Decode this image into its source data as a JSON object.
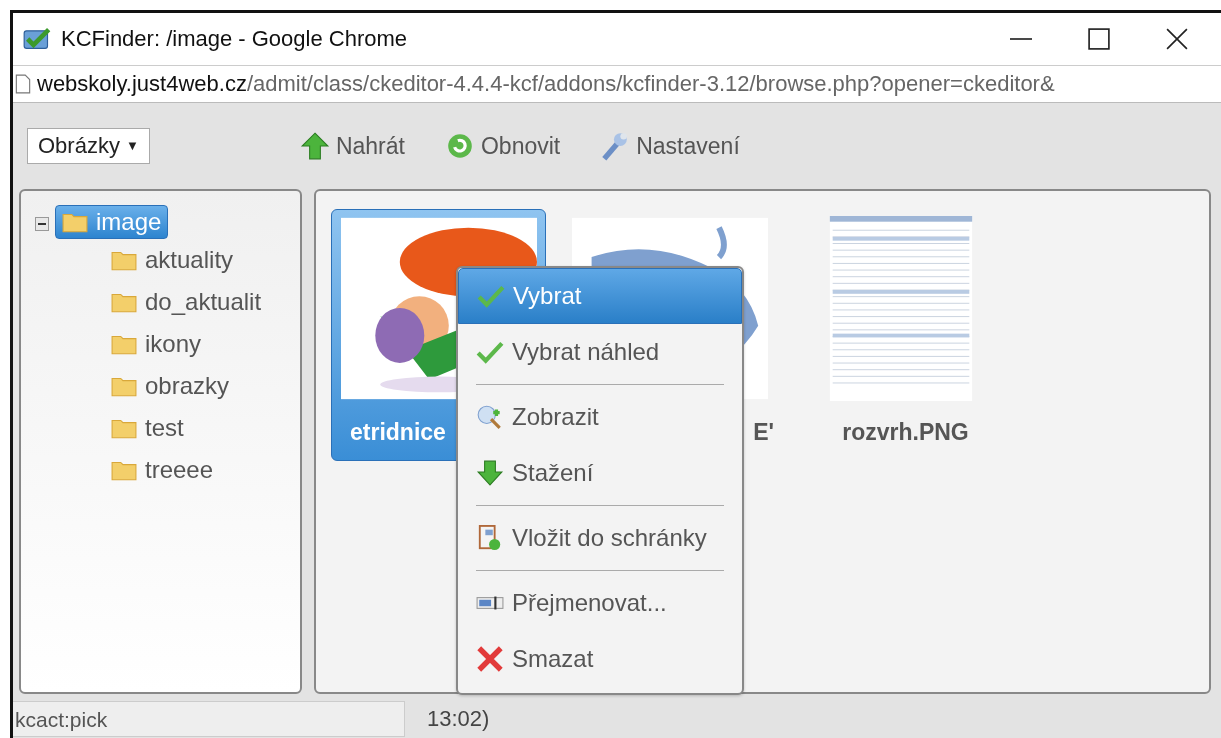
{
  "window": {
    "title": "KCFinder: /image - Google Chrome"
  },
  "address_bar": {
    "host": "webskoly.just4web.cz",
    "path": "/admit/class/ckeditor-4.4.4-kcf/addons/kcfinder-3.12/browse.php?opener=ckeditor&"
  },
  "type_select": {
    "value": "Obrázky",
    "caret": "▼"
  },
  "toolbar": [
    {
      "label": "Nahrát",
      "kind": "upload"
    },
    {
      "label": "Obnovit",
      "kind": "refresh"
    },
    {
      "label": "Nastavení",
      "kind": "settings"
    }
  ],
  "tree": {
    "label": "image",
    "expanded": true,
    "selected": true,
    "children": [
      {
        "label": "aktuality",
        "selected": false
      },
      {
        "label": "do_aktualit",
        "selected": false
      },
      {
        "label": "ikony",
        "selected": false
      },
      {
        "label": "obrazky",
        "selected": false
      },
      {
        "label": "test",
        "selected": false
      },
      {
        "label": "treeee",
        "selected": false
      }
    ]
  },
  "files": [
    {
      "name": "etridnice",
      "selected": true,
      "kind": "cartoon"
    },
    {
      "name": "E'",
      "selected": false,
      "kind": "map"
    },
    {
      "name": "rozvrh.PNG",
      "selected": false,
      "kind": "table"
    }
  ],
  "context_menu": [
    [
      {
        "label": "Vybrat",
        "kind": "check",
        "selected": true
      },
      {
        "label": "Vybrat náhled",
        "kind": "check",
        "selected": false
      }
    ],
    [
      {
        "label": "Zobrazit",
        "kind": "view",
        "selected": false
      },
      {
        "label": "Stažení",
        "kind": "download",
        "selected": false
      }
    ],
    [
      {
        "label": "Vložit do schránky",
        "kind": "clipboard",
        "selected": false
      }
    ],
    [
      {
        "label": "Přejmenovat...",
        "kind": "rename",
        "selected": false
      },
      {
        "label": "Smazat",
        "kind": "delete",
        "selected": false
      }
    ]
  ],
  "status_bar": {
    "link_preview": "kcact:pick",
    "text": "13:02)"
  }
}
